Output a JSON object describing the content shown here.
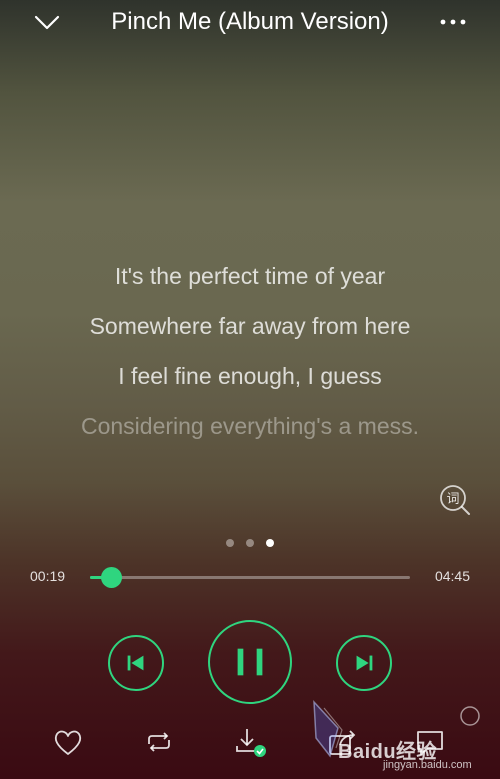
{
  "header": {
    "title": "Pinch Me (Album Version)",
    "back_icon": "chevron-down-icon",
    "more_icon": "more-dots-icon"
  },
  "lyrics": [
    {
      "text": "It's the perfect time of year",
      "state": "normal"
    },
    {
      "text": "Somewhere far away from here",
      "state": "normal"
    },
    {
      "text": "I feel fine enough, I guess",
      "state": "normal"
    },
    {
      "text": "Considering everything's a mess.",
      "state": "dim"
    }
  ],
  "lyric_button": {
    "label": "词",
    "icon": "lyrics-search-icon"
  },
  "pager": {
    "count": 3,
    "active_index": 2
  },
  "progress": {
    "elapsed": "00:19",
    "total": "04:45",
    "fraction": 0.067
  },
  "controls": {
    "prev_icon": "skip-previous-icon",
    "play_icon": "pause-icon",
    "next_icon": "skip-next-icon"
  },
  "bottom_bar": [
    {
      "icon": "heart-icon"
    },
    {
      "icon": "repeat-icon"
    },
    {
      "icon": "download-done-icon"
    },
    {
      "icon": "share-icon"
    },
    {
      "icon": "comment-icon"
    }
  ],
  "watermark": {
    "line1": "Baidu经验",
    "line2": "jingyan.baidu.com"
  },
  "colors": {
    "accent": "#2fd57f",
    "text": "#ffffff"
  }
}
